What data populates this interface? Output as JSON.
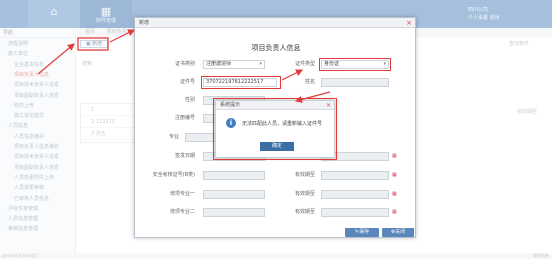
{
  "header": {
    "module_label": "附件管理",
    "user_line1": "四川公司",
    "user_line2": "个人设置",
    "user_line3": "退出"
  },
  "sidebar": {
    "title": "导航",
    "items": [
      "流程说明",
      "施工单位",
      "企业基本信息",
      "项目负责人信息",
      "项目技术负责人信息",
      "项目副职负责人信息",
      "附件上传",
      "施工单位提交",
      "人员信息",
      "人员信息维护",
      "项目负责人信息维护",
      "项目技术负责人信息",
      "项目副职负责人信息",
      "人员变更附件上传",
      "人员变更审核",
      "已审核人员信息",
      "评标专家管理",
      "人员信息管理",
      "审核信息管理"
    ],
    "active_index": 3
  },
  "content": {
    "crumbs": [
      "首页",
      "项目负责人信息"
    ],
    "add_button": "新增",
    "search_label": "搜索:",
    "query_label": "查询条件",
    "col_effective": "有效期至",
    "rows": [
      "1",
      "2",
      "3"
    ],
    "row_values": [
      "",
      "123213",
      "张志"
    ]
  },
  "dialog": {
    "window_title": "新增",
    "title": "项目负责人信息",
    "fields": {
      "id_type_label": "证书类别",
      "id_type_value": "注册建造师",
      "cert_type_label": "证件类型",
      "cert_type_value": "身份证",
      "id_no_label": "证件号",
      "id_no_value": "370722197612222517",
      "name_label": "姓名",
      "gender_label": "性别",
      "reg_no_label": "注册编号",
      "major_label": "专业",
      "issue_date_label": "签发日期",
      "safety_cert_label": "安全考核证号(B类)",
      "project_major1_label": "增项专业一",
      "project_major2_label": "增项专业二",
      "valid_label": "有效期至"
    },
    "save_button": "保存",
    "close_button": "关闭"
  },
  "alert": {
    "title": "系统提示",
    "message": "无法匹配此人员，请重新输入证件号",
    "ok_button": "确定"
  },
  "footer": {
    "left": "javascript:void(0)",
    "right": "版权所有"
  }
}
